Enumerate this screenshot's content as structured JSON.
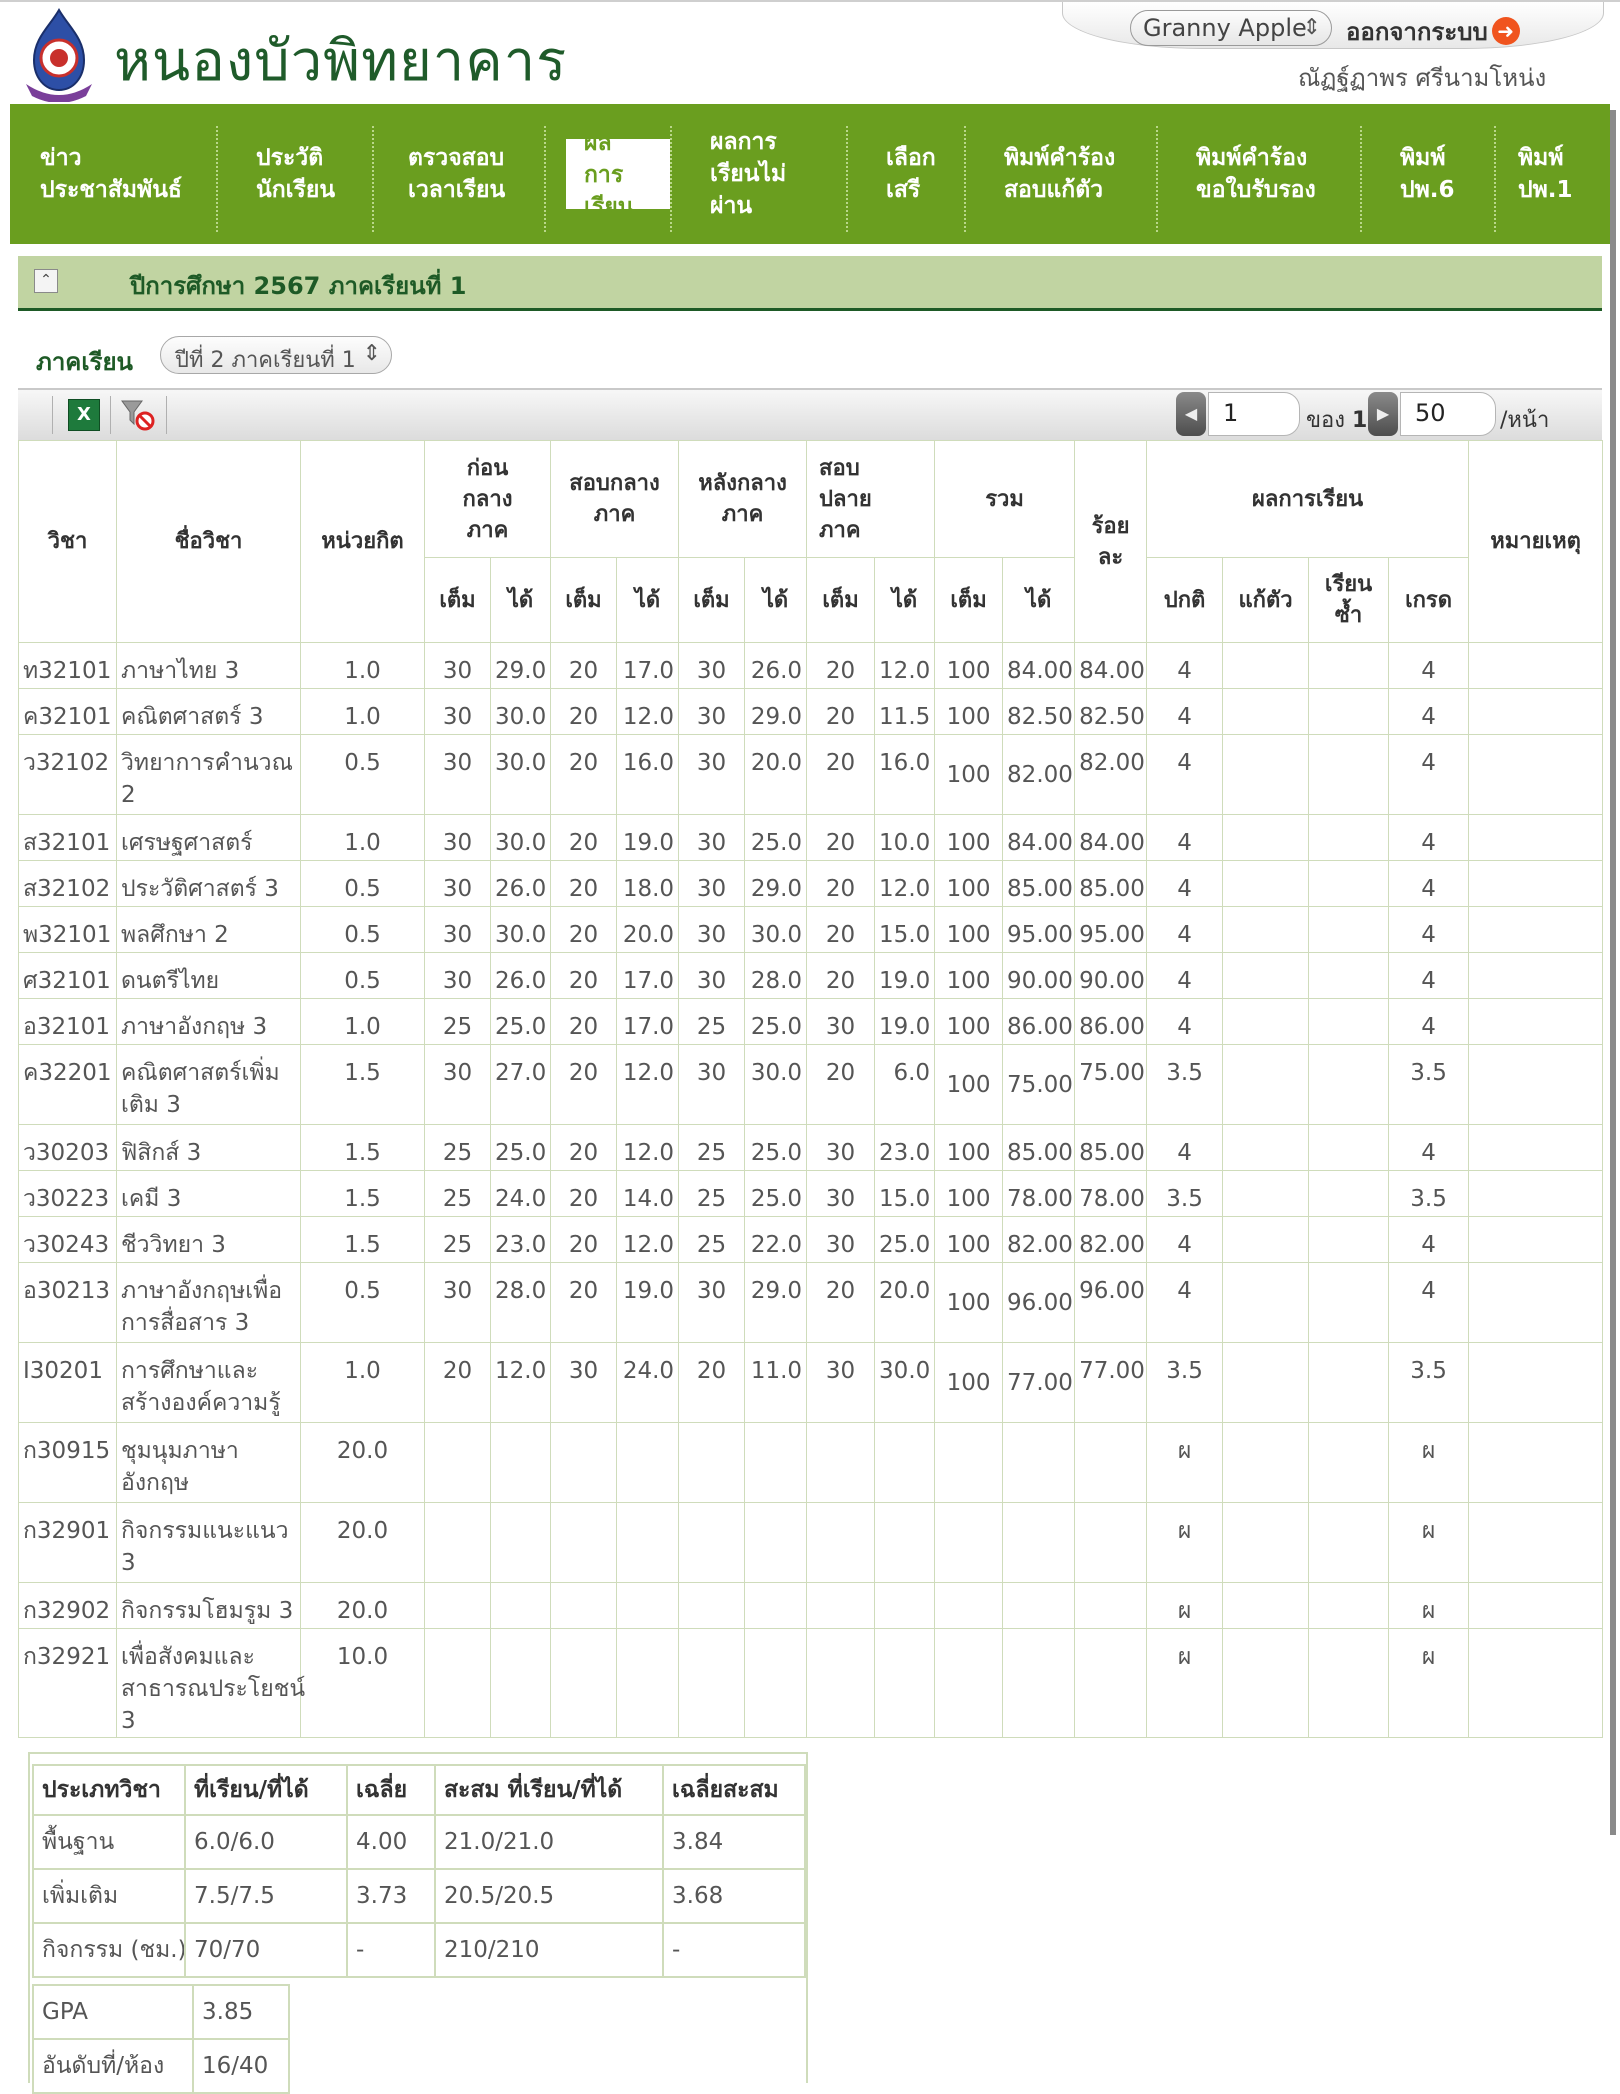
{
  "header": {
    "school_name": "หนองบัวพิทยาคาร",
    "name_select": "Granny Apple",
    "logout_label": "ออกจากระบบ",
    "username": "ณัฏฐ์ฏาพร ศรีนามโหน่ง"
  },
  "nav": {
    "items": [
      {
        "line1": "ข่าว",
        "line2": "ประชาสัมพันธ์"
      },
      {
        "line1": "ประวัติ",
        "line2": "นักเรียน"
      },
      {
        "line1": "ตรวจสอบ",
        "line2": "เวลาเรียน"
      },
      {
        "line1": "ผล",
        "line2": "การ",
        "line3": "เรียน"
      },
      {
        "line1": "ผลการ",
        "line2": "เรียนไม่",
        "line3": "ผ่าน"
      },
      {
        "line1": "เลือก",
        "line2": "เสรี"
      },
      {
        "line1": "พิมพ์คำร้อง",
        "line2": "สอบแก้ตัว"
      },
      {
        "line1": "พิมพ์คำร้อง",
        "line2": "ขอใบรับรอง"
      },
      {
        "line1": "พิมพ์",
        "line2": "ปพ.6"
      },
      {
        "line1": "พิมพ์",
        "line2": "ปพ.1"
      }
    ]
  },
  "section": {
    "title": "ปีการศึกษา 2567 ภาคเรียนที่ 1"
  },
  "filter": {
    "label": "ภาคเรียน",
    "value": "ปีที่ 2 ภาคเรียนที่ 1"
  },
  "toolbar": {
    "page": "1",
    "of_label": "ของ",
    "total_pages": "1",
    "page_size": "50",
    "per_page_label": "/หน้า"
  },
  "table": {
    "headers": {
      "code": "วิชา",
      "name": "ชื่อวิชา",
      "credit": "หน่วยกิต",
      "pre_mid": "ก่อนกลางภาค",
      "mid": "สอบกลางภาค",
      "post_mid": "หลังกลางภาค",
      "final": "สอบปลายภาค",
      "total": "รวม",
      "percent": "ร้อยละ",
      "result": "ผลการเรียน",
      "remark": "หมายเหตุ",
      "full": "เต็ม",
      "got": "ได้",
      "normal": "ปกติ",
      "remedial": "แก้ตัว",
      "repeat": "เรียนซ้ำ",
      "grade": "เกรด"
    },
    "rows": [
      {
        "code": "ท32101",
        "name": "ภาษาไทย 3",
        "credit": "1.0",
        "pm_f": "30",
        "pm_g": "29.0",
        "m_f": "20",
        "m_g": "17.0",
        "po_f": "30",
        "po_g": "26.0",
        "f_f": "20",
        "f_g": "12.0",
        "t_f": "100",
        "t_g": "84.00",
        "pct": "84.00",
        "normal": "4",
        "remedial": "",
        "repeat": "",
        "grade": "4",
        "remark": ""
      },
      {
        "code": "ค32101",
        "name": "คณิตศาสตร์ 3",
        "credit": "1.0",
        "pm_f": "30",
        "pm_g": "30.0",
        "m_f": "20",
        "m_g": "12.0",
        "po_f": "30",
        "po_g": "29.0",
        "f_f": "20",
        "f_g": "11.5",
        "t_f": "100",
        "t_g": "82.50",
        "pct": "82.50",
        "normal": "4",
        "remedial": "",
        "repeat": "",
        "grade": "4",
        "remark": ""
      },
      {
        "code": "ว32102",
        "name": "วิทยาการคำนวณ 2",
        "credit": "0.5",
        "pm_f": "30",
        "pm_g": "30.0",
        "m_f": "20",
        "m_g": "16.0",
        "po_f": "30",
        "po_g": "20.0",
        "f_f": "20",
        "f_g": "16.0",
        "t_f": "100",
        "t_g": "82.00",
        "pct": "82.00",
        "normal": "4",
        "remedial": "",
        "repeat": "",
        "grade": "4",
        "remark": "",
        "tall": true
      },
      {
        "code": "ส32101",
        "name": "เศรษฐศาสตร์",
        "credit": "1.0",
        "pm_f": "30",
        "pm_g": "30.0",
        "m_f": "20",
        "m_g": "19.0",
        "po_f": "30",
        "po_g": "25.0",
        "f_f": "20",
        "f_g": "10.0",
        "t_f": "100",
        "t_g": "84.00",
        "pct": "84.00",
        "normal": "4",
        "remedial": "",
        "repeat": "",
        "grade": "4",
        "remark": ""
      },
      {
        "code": "ส32102",
        "name": "ประวัติศาสตร์ 3",
        "credit": "0.5",
        "pm_f": "30",
        "pm_g": "26.0",
        "m_f": "20",
        "m_g": "18.0",
        "po_f": "30",
        "po_g": "29.0",
        "f_f": "20",
        "f_g": "12.0",
        "t_f": "100",
        "t_g": "85.00",
        "pct": "85.00",
        "normal": "4",
        "remedial": "",
        "repeat": "",
        "grade": "4",
        "remark": ""
      },
      {
        "code": "พ32101",
        "name": "พลศึกษา 2",
        "credit": "0.5",
        "pm_f": "30",
        "pm_g": "30.0",
        "m_f": "20",
        "m_g": "20.0",
        "po_f": "30",
        "po_g": "30.0",
        "f_f": "20",
        "f_g": "15.0",
        "t_f": "100",
        "t_g": "95.00",
        "pct": "95.00",
        "normal": "4",
        "remedial": "",
        "repeat": "",
        "grade": "4",
        "remark": ""
      },
      {
        "code": "ศ32101",
        "name": "ดนตรีไทย",
        "credit": "0.5",
        "pm_f": "30",
        "pm_g": "26.0",
        "m_f": "20",
        "m_g": "17.0",
        "po_f": "30",
        "po_g": "28.0",
        "f_f": "20",
        "f_g": "19.0",
        "t_f": "100",
        "t_g": "90.00",
        "pct": "90.00",
        "normal": "4",
        "remedial": "",
        "repeat": "",
        "grade": "4",
        "remark": ""
      },
      {
        "code": "อ32101",
        "name": "ภาษาอังกฤษ 3",
        "credit": "1.0",
        "pm_f": "25",
        "pm_g": "25.0",
        "m_f": "20",
        "m_g": "17.0",
        "po_f": "25",
        "po_g": "25.0",
        "f_f": "30",
        "f_g": "19.0",
        "t_f": "100",
        "t_g": "86.00",
        "pct": "86.00",
        "normal": "4",
        "remedial": "",
        "repeat": "",
        "grade": "4",
        "remark": ""
      },
      {
        "code": "ค32201",
        "name": "คณิตศาสตร์เพิ่มเติม 3",
        "credit": "1.5",
        "pm_f": "30",
        "pm_g": "27.0",
        "m_f": "20",
        "m_g": "12.0",
        "po_f": "30",
        "po_g": "30.0",
        "f_f": "20",
        "f_g": "6.0",
        "t_f": "100",
        "t_g": "75.00",
        "pct": "75.00",
        "normal": "3.5",
        "remedial": "",
        "repeat": "",
        "grade": "3.5",
        "remark": "",
        "tall": true
      },
      {
        "code": "ว30203",
        "name": "ฟิสิกส์ 3",
        "credit": "1.5",
        "pm_f": "25",
        "pm_g": "25.0",
        "m_f": "20",
        "m_g": "12.0",
        "po_f": "25",
        "po_g": "25.0",
        "f_f": "30",
        "f_g": "23.0",
        "t_f": "100",
        "t_g": "85.00",
        "pct": "85.00",
        "normal": "4",
        "remedial": "",
        "repeat": "",
        "grade": "4",
        "remark": ""
      },
      {
        "code": "ว30223",
        "name": "เคมี 3",
        "credit": "1.5",
        "pm_f": "25",
        "pm_g": "24.0",
        "m_f": "20",
        "m_g": "14.0",
        "po_f": "25",
        "po_g": "25.0",
        "f_f": "30",
        "f_g": "15.0",
        "t_f": "100",
        "t_g": "78.00",
        "pct": "78.00",
        "normal": "3.5",
        "remedial": "",
        "repeat": "",
        "grade": "3.5",
        "remark": ""
      },
      {
        "code": "ว30243",
        "name": "ชีววิทยา 3",
        "credit": "1.5",
        "pm_f": "25",
        "pm_g": "23.0",
        "m_f": "20",
        "m_g": "12.0",
        "po_f": "25",
        "po_g": "22.0",
        "f_f": "30",
        "f_g": "25.0",
        "t_f": "100",
        "t_g": "82.00",
        "pct": "82.00",
        "normal": "4",
        "remedial": "",
        "repeat": "",
        "grade": "4",
        "remark": ""
      },
      {
        "code": "อ30213",
        "name": "ภาษาอังกฤษเพื่อการสื่อสาร 3",
        "credit": "0.5",
        "pm_f": "30",
        "pm_g": "28.0",
        "m_f": "20",
        "m_g": "19.0",
        "po_f": "30",
        "po_g": "29.0",
        "f_f": "20",
        "f_g": "20.0",
        "t_f": "100",
        "t_g": "96.00",
        "pct": "96.00",
        "normal": "4",
        "remedial": "",
        "repeat": "",
        "grade": "4",
        "remark": "",
        "tall": true
      },
      {
        "code": "I30201",
        "name": "การศึกษาและสร้างองค์ความรู้",
        "credit": "1.0",
        "pm_f": "20",
        "pm_g": "12.0",
        "m_f": "30",
        "m_g": "24.0",
        "po_f": "20",
        "po_g": "11.0",
        "f_f": "30",
        "f_g": "30.0",
        "t_f": "100",
        "t_g": "77.00",
        "pct": "77.00",
        "normal": "3.5",
        "remedial": "",
        "repeat": "",
        "grade": "3.5",
        "remark": "",
        "tall": true
      },
      {
        "code": "ก30915",
        "name": "ชุมนุมภาษาอังกฤษ",
        "credit": "20.0",
        "pm_f": "",
        "pm_g": "",
        "m_f": "",
        "m_g": "",
        "po_f": "",
        "po_g": "",
        "f_f": "",
        "f_g": "",
        "t_f": "",
        "t_g": "",
        "pct": "",
        "normal": "ผ",
        "remedial": "",
        "repeat": "",
        "grade": "ผ",
        "remark": "",
        "tall": true
      },
      {
        "code": "ก32901",
        "name": "กิจกรรมแนะแนว 3",
        "credit": "20.0",
        "pm_f": "",
        "pm_g": "",
        "m_f": "",
        "m_g": "",
        "po_f": "",
        "po_g": "",
        "f_f": "",
        "f_g": "",
        "t_f": "",
        "t_g": "",
        "pct": "",
        "normal": "ผ",
        "remedial": "",
        "repeat": "",
        "grade": "ผ",
        "remark": "",
        "tall": true
      },
      {
        "code": "ก32902",
        "name": "กิจกรรมโฮมรูม 3",
        "credit": "20.0",
        "pm_f": "",
        "pm_g": "",
        "m_f": "",
        "m_g": "",
        "po_f": "",
        "po_g": "",
        "f_f": "",
        "f_g": "",
        "t_f": "",
        "t_g": "",
        "pct": "",
        "normal": "ผ",
        "remedial": "",
        "repeat": "",
        "grade": "ผ",
        "remark": ""
      },
      {
        "code": "ก32921",
        "name": "เพื่อสังคมและสาธารณประโยชน์ 3",
        "credit": "10.0",
        "pm_f": "",
        "pm_g": "",
        "m_f": "",
        "m_g": "",
        "po_f": "",
        "po_g": "",
        "f_f": "",
        "f_g": "",
        "t_f": "",
        "t_g": "",
        "pct": "",
        "normal": "ผ",
        "remedial": "",
        "repeat": "",
        "grade": "ผ",
        "remark": "",
        "xtall": true
      }
    ]
  },
  "summary": {
    "headers": [
      "ประเภทวิชา",
      "ที่เรียน/ที่ได้",
      "เฉลี่ย",
      "สะสม ที่เรียน/ที่ได้",
      "เฉลี่ยสะสม"
    ],
    "rows": [
      [
        "พื้นฐาน",
        "6.0/6.0",
        "4.00",
        "21.0/21.0",
        "3.84"
      ],
      [
        "เพิ่มเติม",
        "7.5/7.5",
        "3.73",
        "20.5/20.5",
        "3.68"
      ],
      [
        "กิจกรรม (ชม.)",
        "70/70",
        "-",
        "210/210",
        "-"
      ]
    ],
    "gpa_label": "GPA",
    "gpa_value": "3.85",
    "rank_label": "อันดับที่/ห้อง",
    "rank_value": "16/40"
  },
  "colors": {
    "nav_green": "#6a9e1f",
    "section_green": "#c1d4a2",
    "title_green": "#1e5a26",
    "border": "#cfdcbb"
  }
}
